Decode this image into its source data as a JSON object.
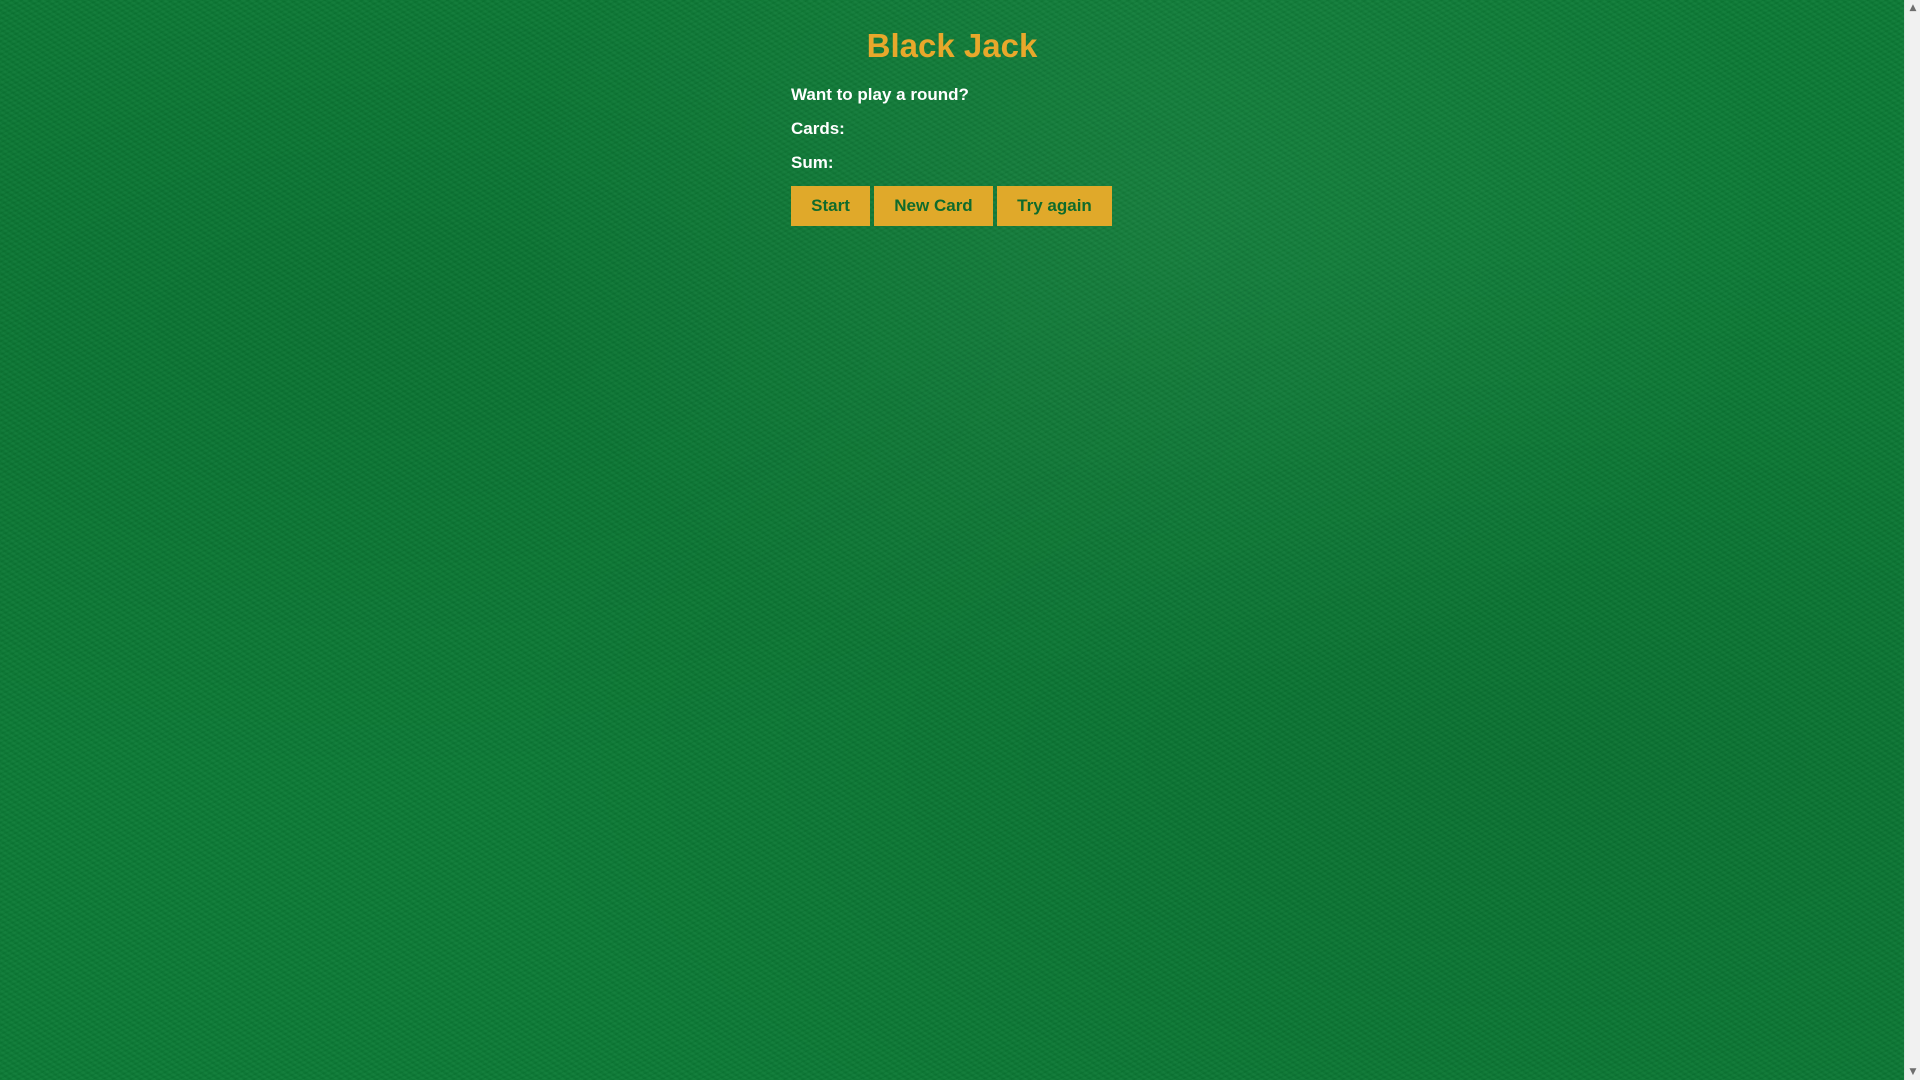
{
  "game": {
    "title": "Black Jack",
    "message": "Want to play a round?",
    "cards_label": "Cards:",
    "cards_value": "",
    "sum_label": "Sum:",
    "sum_value": ""
  },
  "buttons": {
    "start": "Start",
    "new_card": "New Card",
    "try_again": "Try again"
  },
  "scrollbar": {
    "up_icon": "▲",
    "down_icon": "▼"
  },
  "colors": {
    "background": "#0b7a35",
    "title": "#e8a82b",
    "button": "#e0a92a",
    "button_text": "#0f6b2c"
  }
}
